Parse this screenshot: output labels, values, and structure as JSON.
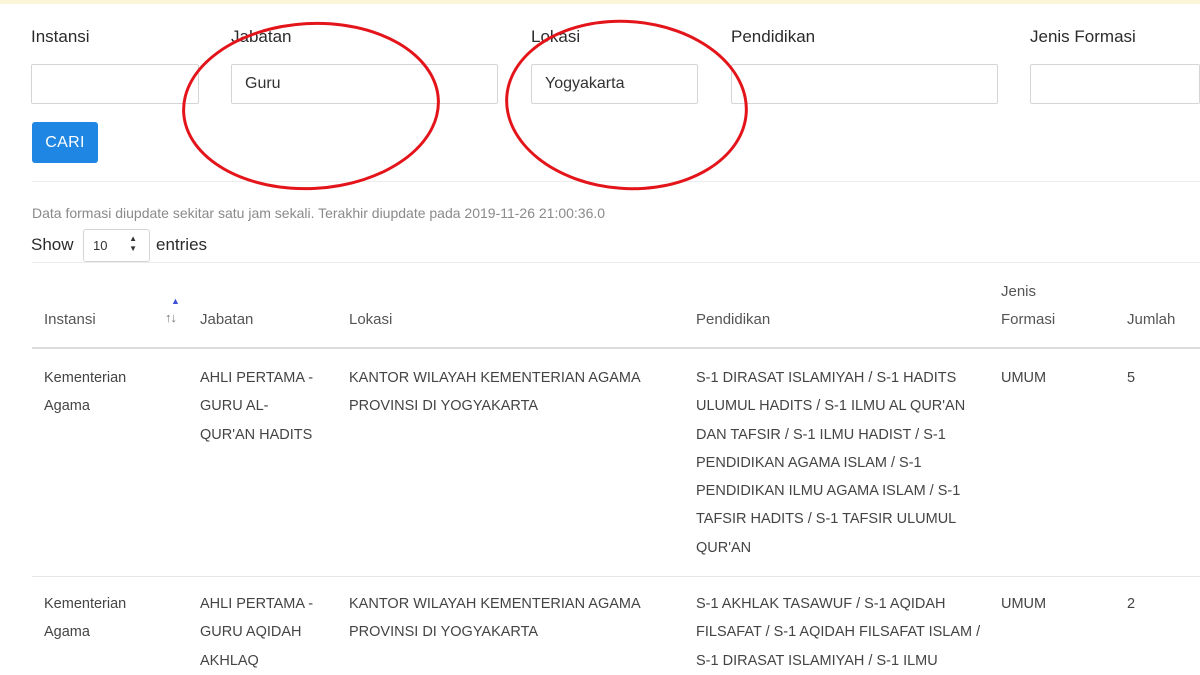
{
  "filters": {
    "instansi": {
      "label": "Instansi",
      "value": ""
    },
    "jabatan": {
      "label": "Jabatan",
      "value": "Guru"
    },
    "lokasi": {
      "label": "Lokasi",
      "value": "Yogyakarta"
    },
    "pendidikan": {
      "label": "Pendidikan",
      "value": ""
    },
    "jenis_formasi": {
      "label": "Jenis Formasi",
      "value": ""
    },
    "search_button": "CARI"
  },
  "update_note": "Data formasi diupdate sekitar satu jam sekali. Terakhir diupdate pada 2019-11-26 21:00:36.0",
  "length_menu": {
    "show_label": "Show",
    "value": "10",
    "entries_label": "entries"
  },
  "table": {
    "headers": {
      "instansi": "Instansi",
      "jabatan": "Jabatan",
      "lokasi": "Lokasi",
      "pendidikan": "Pendidikan",
      "jenis_formasi_1": "Jenis",
      "jenis_formasi_2": "Formasi",
      "jumlah": "Jumlah"
    },
    "rows": [
      {
        "instansi": [
          "Kementerian",
          "Agama"
        ],
        "jabatan": [
          "AHLI PERTAMA -",
          "GURU AL-",
          "QUR'AN HADITS"
        ],
        "lokasi": [
          "KANTOR WILAYAH KEMENTERIAN AGAMA",
          "PROVINSI DI YOGYAKARTA"
        ],
        "pendidikan": [
          "S-1 DIRASAT ISLAMIYAH / S-1 HADITS",
          "ULUMUL HADITS / S-1 ILMU AL QUR'AN",
          "DAN TAFSIR / S-1 ILMU HADIST / S-1",
          "PENDIDIKAN AGAMA ISLAM / S-1",
          "PENDIDIKAN ILMU AGAMA ISLAM / S-1",
          "TAFSIR HADITS / S-1 TAFSIR ULUMUL",
          "QUR'AN"
        ],
        "jenis_formasi": "UMUM",
        "jumlah": "5"
      },
      {
        "instansi": [
          "Kementerian",
          "Agama"
        ],
        "jabatan": [
          "AHLI PERTAMA -",
          "GURU AQIDAH",
          "AKHLAQ"
        ],
        "lokasi": [
          "KANTOR WILAYAH KEMENTERIAN AGAMA",
          "PROVINSI DI YOGYAKARTA"
        ],
        "pendidikan": [
          "S-1 AKHLAK TASAWUF / S-1 AQIDAH",
          "FILSAFAT / S-1 AQIDAH FILSAFAT ISLAM /",
          "S-1 DIRASAT ISLAMIYAH / S-1 ILMU"
        ],
        "jenis_formasi": "UMUM",
        "jumlah": "2"
      }
    ]
  },
  "annotation_color": "#e3151b",
  "accent_color": "#1f86e3"
}
